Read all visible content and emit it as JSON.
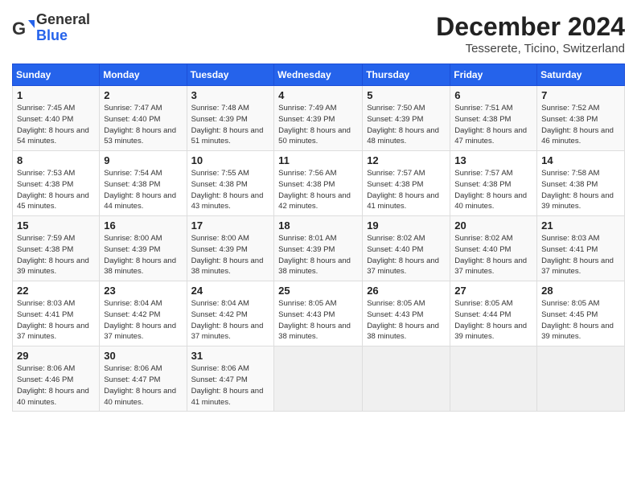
{
  "logo": {
    "general": "General",
    "blue": "Blue"
  },
  "title": {
    "month": "December 2024",
    "location": "Tesserete, Ticino, Switzerland"
  },
  "headers": [
    "Sunday",
    "Monday",
    "Tuesday",
    "Wednesday",
    "Thursday",
    "Friday",
    "Saturday"
  ],
  "weeks": [
    [
      {
        "day": "1",
        "sunrise": "Sunrise: 7:45 AM",
        "sunset": "Sunset: 4:40 PM",
        "daylight": "Daylight: 8 hours and 54 minutes."
      },
      {
        "day": "2",
        "sunrise": "Sunrise: 7:47 AM",
        "sunset": "Sunset: 4:40 PM",
        "daylight": "Daylight: 8 hours and 53 minutes."
      },
      {
        "day": "3",
        "sunrise": "Sunrise: 7:48 AM",
        "sunset": "Sunset: 4:39 PM",
        "daylight": "Daylight: 8 hours and 51 minutes."
      },
      {
        "day": "4",
        "sunrise": "Sunrise: 7:49 AM",
        "sunset": "Sunset: 4:39 PM",
        "daylight": "Daylight: 8 hours and 50 minutes."
      },
      {
        "day": "5",
        "sunrise": "Sunrise: 7:50 AM",
        "sunset": "Sunset: 4:39 PM",
        "daylight": "Daylight: 8 hours and 48 minutes."
      },
      {
        "day": "6",
        "sunrise": "Sunrise: 7:51 AM",
        "sunset": "Sunset: 4:38 PM",
        "daylight": "Daylight: 8 hours and 47 minutes."
      },
      {
        "day": "7",
        "sunrise": "Sunrise: 7:52 AM",
        "sunset": "Sunset: 4:38 PM",
        "daylight": "Daylight: 8 hours and 46 minutes."
      }
    ],
    [
      {
        "day": "8",
        "sunrise": "Sunrise: 7:53 AM",
        "sunset": "Sunset: 4:38 PM",
        "daylight": "Daylight: 8 hours and 45 minutes."
      },
      {
        "day": "9",
        "sunrise": "Sunrise: 7:54 AM",
        "sunset": "Sunset: 4:38 PM",
        "daylight": "Daylight: 8 hours and 44 minutes."
      },
      {
        "day": "10",
        "sunrise": "Sunrise: 7:55 AM",
        "sunset": "Sunset: 4:38 PM",
        "daylight": "Daylight: 8 hours and 43 minutes."
      },
      {
        "day": "11",
        "sunrise": "Sunrise: 7:56 AM",
        "sunset": "Sunset: 4:38 PM",
        "daylight": "Daylight: 8 hours and 42 minutes."
      },
      {
        "day": "12",
        "sunrise": "Sunrise: 7:57 AM",
        "sunset": "Sunset: 4:38 PM",
        "daylight": "Daylight: 8 hours and 41 minutes."
      },
      {
        "day": "13",
        "sunrise": "Sunrise: 7:57 AM",
        "sunset": "Sunset: 4:38 PM",
        "daylight": "Daylight: 8 hours and 40 minutes."
      },
      {
        "day": "14",
        "sunrise": "Sunrise: 7:58 AM",
        "sunset": "Sunset: 4:38 PM",
        "daylight": "Daylight: 8 hours and 39 minutes."
      }
    ],
    [
      {
        "day": "15",
        "sunrise": "Sunrise: 7:59 AM",
        "sunset": "Sunset: 4:38 PM",
        "daylight": "Daylight: 8 hours and 39 minutes."
      },
      {
        "day": "16",
        "sunrise": "Sunrise: 8:00 AM",
        "sunset": "Sunset: 4:39 PM",
        "daylight": "Daylight: 8 hours and 38 minutes."
      },
      {
        "day": "17",
        "sunrise": "Sunrise: 8:00 AM",
        "sunset": "Sunset: 4:39 PM",
        "daylight": "Daylight: 8 hours and 38 minutes."
      },
      {
        "day": "18",
        "sunrise": "Sunrise: 8:01 AM",
        "sunset": "Sunset: 4:39 PM",
        "daylight": "Daylight: 8 hours and 38 minutes."
      },
      {
        "day": "19",
        "sunrise": "Sunrise: 8:02 AM",
        "sunset": "Sunset: 4:40 PM",
        "daylight": "Daylight: 8 hours and 37 minutes."
      },
      {
        "day": "20",
        "sunrise": "Sunrise: 8:02 AM",
        "sunset": "Sunset: 4:40 PM",
        "daylight": "Daylight: 8 hours and 37 minutes."
      },
      {
        "day": "21",
        "sunrise": "Sunrise: 8:03 AM",
        "sunset": "Sunset: 4:41 PM",
        "daylight": "Daylight: 8 hours and 37 minutes."
      }
    ],
    [
      {
        "day": "22",
        "sunrise": "Sunrise: 8:03 AM",
        "sunset": "Sunset: 4:41 PM",
        "daylight": "Daylight: 8 hours and 37 minutes."
      },
      {
        "day": "23",
        "sunrise": "Sunrise: 8:04 AM",
        "sunset": "Sunset: 4:42 PM",
        "daylight": "Daylight: 8 hours and 37 minutes."
      },
      {
        "day": "24",
        "sunrise": "Sunrise: 8:04 AM",
        "sunset": "Sunset: 4:42 PM",
        "daylight": "Daylight: 8 hours and 37 minutes."
      },
      {
        "day": "25",
        "sunrise": "Sunrise: 8:05 AM",
        "sunset": "Sunset: 4:43 PM",
        "daylight": "Daylight: 8 hours and 38 minutes."
      },
      {
        "day": "26",
        "sunrise": "Sunrise: 8:05 AM",
        "sunset": "Sunset: 4:43 PM",
        "daylight": "Daylight: 8 hours and 38 minutes."
      },
      {
        "day": "27",
        "sunrise": "Sunrise: 8:05 AM",
        "sunset": "Sunset: 4:44 PM",
        "daylight": "Daylight: 8 hours and 39 minutes."
      },
      {
        "day": "28",
        "sunrise": "Sunrise: 8:05 AM",
        "sunset": "Sunset: 4:45 PM",
        "daylight": "Daylight: 8 hours and 39 minutes."
      }
    ],
    [
      {
        "day": "29",
        "sunrise": "Sunrise: 8:06 AM",
        "sunset": "Sunset: 4:46 PM",
        "daylight": "Daylight: 8 hours and 40 minutes."
      },
      {
        "day": "30",
        "sunrise": "Sunrise: 8:06 AM",
        "sunset": "Sunset: 4:47 PM",
        "daylight": "Daylight: 8 hours and 40 minutes."
      },
      {
        "day": "31",
        "sunrise": "Sunrise: 8:06 AM",
        "sunset": "Sunset: 4:47 PM",
        "daylight": "Daylight: 8 hours and 41 minutes."
      },
      null,
      null,
      null,
      null
    ]
  ]
}
